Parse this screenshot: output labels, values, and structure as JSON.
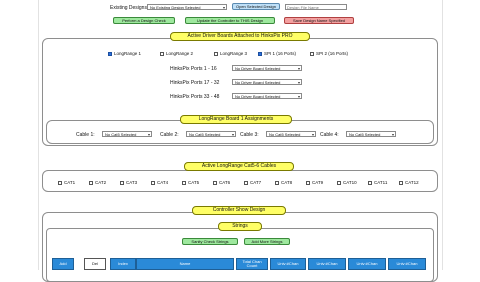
{
  "existing": {
    "label": "Existing Designs:",
    "select": "No Existing Design Selected",
    "open_btn": "Open Selected Design",
    "name_ph": "Design File Name"
  },
  "actions": {
    "check": "Perform a Design Check",
    "update": "Update the Controller to THIS Design",
    "save": "Save Design Name Specified"
  },
  "driver": {
    "title": "Active Driver Boards Attached to HinksPix PRO",
    "boards": [
      {
        "label": "LongRange 1",
        "checked": true
      },
      {
        "label": "LongRange 2",
        "checked": false
      },
      {
        "label": "LongRange 3",
        "checked": false
      },
      {
        "label": "SPI 1 (16 Ports)",
        "checked": true
      },
      {
        "label": "SPI 2 (16 Ports)",
        "checked": false
      }
    ],
    "ports": [
      {
        "label": "HinksPix Ports 1 - 16",
        "value": "No Driver Board Selected"
      },
      {
        "label": "HinksPix Ports 17 - 32",
        "value": "No Driver Board Selected"
      },
      {
        "label": "HinksPix Ports 33 - 48",
        "value": "No Driver Board Selected"
      }
    ]
  },
  "longrange": {
    "title": "LongRange Board 1 Assignments",
    "cables": [
      {
        "label": "Cable 1:",
        "value": "No Cat5 Selected"
      },
      {
        "label": "Cable 2:",
        "value": "No Cat5 Selected"
      },
      {
        "label": "Cable 3:",
        "value": "No Cat5 Selected"
      },
      {
        "label": "Cable 4:",
        "value": "No Cat5 Selected"
      }
    ]
  },
  "cat5": {
    "title": "Active LongRange Cat5-6 Cables",
    "items": [
      "CAT1",
      "CAT2",
      "CAT3",
      "CAT4",
      "CAT5",
      "CAT6",
      "CAT7",
      "CAT8",
      "CAT9",
      "CAT10",
      "CAT11",
      "CAT12"
    ]
  },
  "show": {
    "title": "Controller Show Design",
    "strings_title": "Strings",
    "sanity": "Sanity Check Strings",
    "add_more": "Add More Strings",
    "headers": [
      "Add",
      "Del",
      "Index",
      "Name",
      "Total Chan Count",
      "Univ:#Chan",
      "Univ:#Chan",
      "Univ:#Chan",
      "Univ:#Chan"
    ]
  }
}
